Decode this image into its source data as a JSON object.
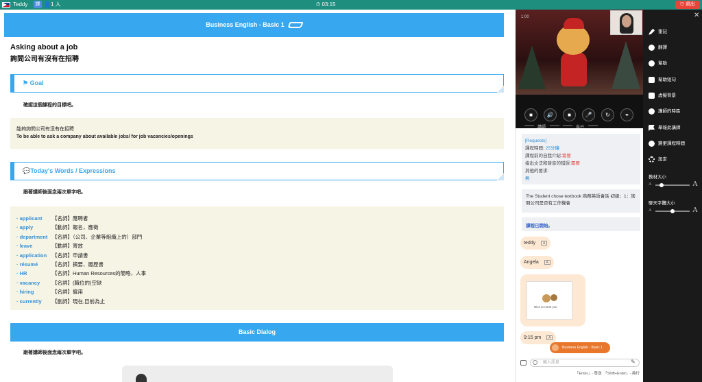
{
  "topbar": {
    "user_name": "Teddy",
    "translate_icon_text": "譯",
    "participants": "1 ",
    "timer": "03:15",
    "exit_label": "退出"
  },
  "lesson": {
    "banner_title": "Business English - Basic 1",
    "title_en": "Asking about a job",
    "title_zh": "詢問公司有沒有在招聘",
    "goal_header": "Goal",
    "goal_sub": "確認這個課程的目標吧。",
    "goal_zh": "能夠詢問公司有沒有在招聘",
    "goal_en": "To be able to ask a company about available jobs/ for job vacancies/openings",
    "words_header": "Today's Words / Expressions",
    "words_sub": "跟著講師後面念兩次單字吧。",
    "words": [
      {
        "word": "applicant",
        "def": "【名詞】應聘者"
      },
      {
        "word": "apply",
        "def": "【動詞】報名，應徵"
      },
      {
        "word": "department",
        "def": "【名詞】（公司、企業等組織上的）部門"
      },
      {
        "word": "leave",
        "def": "【動詞】寄放"
      },
      {
        "word": "application",
        "def": "【名詞】申請書"
      },
      {
        "word": "résumé",
        "def": "【名詞】摘要、履歷書"
      },
      {
        "word": "HR",
        "def": "【名詞】Human Resources的簡略，人事"
      },
      {
        "word": "vacancy",
        "def": "【名詞】(職位的)空缺"
      },
      {
        "word": "hiring",
        "def": "【名詞】僱用"
      },
      {
        "word": "currently",
        "def": "【副詞】現在,目前為止"
      }
    ],
    "dialog_header": "Basic Dialog",
    "dialog_sub": "跟著講師後面念兩次單字吧。"
  },
  "video": {
    "time": "1:00",
    "tutor_label": "講師",
    "self_label": "自己"
  },
  "chat": {
    "requests_title": "[Requests]",
    "req_lines": [
      {
        "label": "課程時間: ",
        "value": "25分鐘",
        "color": "blue"
      },
      {
        "label": "課程前的自我介紹:",
        "value": "需要",
        "color": "red"
      },
      {
        "label": "指出文法和發音的錯誤:",
        "value": "需要",
        "color": "red"
      },
      {
        "label": "其他的要求:",
        "value": "",
        "color": "none"
      },
      {
        "label": "",
        "value": "無",
        "color": "blue"
      }
    ],
    "chose_text": "The Student chose textbook 商務英語會話 初級：1：詢問公司是否有工作機會",
    "started_text": "課程已開始。",
    "msgs": [
      {
        "text": "teddy",
        "tr": "A"
      },
      {
        "text": "Angela",
        "tr": "A"
      }
    ],
    "sticker_text": "Nice to meet you",
    "time_msg": "9:15 pm",
    "course_pill": "Business English - Basic 1",
    "input_placeholder": "輸入訊息",
    "hint": "「Enter」- 發送　「Shift+Enter」- 換行"
  },
  "sidebar": {
    "items": [
      {
        "label": "筆記",
        "icon": "pencil-icon"
      },
      {
        "label": "翻譯",
        "icon": "globe-icon"
      },
      {
        "label": "幫助",
        "icon": "help-icon"
      },
      {
        "label": "幫助短句",
        "icon": "phrase-icon"
      },
      {
        "label": "虛擬背景",
        "icon": "background-icon"
      },
      {
        "label": "講師的時區",
        "icon": "timezone-icon"
      },
      {
        "label": "舉報此講師",
        "icon": "flag-icon"
      },
      {
        "label": "變更課程時間",
        "icon": "reschedule-icon"
      },
      {
        "label": "設定",
        "icon": "gear-icon"
      }
    ],
    "material_size_label": "教材大小",
    "chat_size_label": "聊天字體大小",
    "material_size_level": 0.18,
    "chat_size_level": 0.5
  }
}
